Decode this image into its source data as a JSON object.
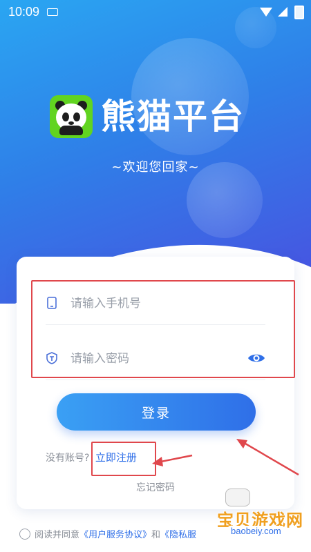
{
  "status_bar": {
    "time": "10:09"
  },
  "brand": {
    "name": "熊猫平台",
    "welcome": "~欢迎您回家~"
  },
  "form": {
    "phone_placeholder": "请输入手机号",
    "password_placeholder": "请输入密码",
    "login_label": "登录"
  },
  "register": {
    "prompt": "没有账号?",
    "link": "立即注册"
  },
  "forgot_label": "忘记密码",
  "agreement": {
    "prefix": "阅读并同意",
    "terms": "《用户服务协议》",
    "and": "和",
    "privacy": "《隐私服"
  },
  "watermark": {
    "title": "宝贝游戏网",
    "url": "baobeiy.com"
  },
  "colors": {
    "primary": "#2f6fe8",
    "highlight": "#e0474c",
    "logo_bg": "#61d420"
  }
}
